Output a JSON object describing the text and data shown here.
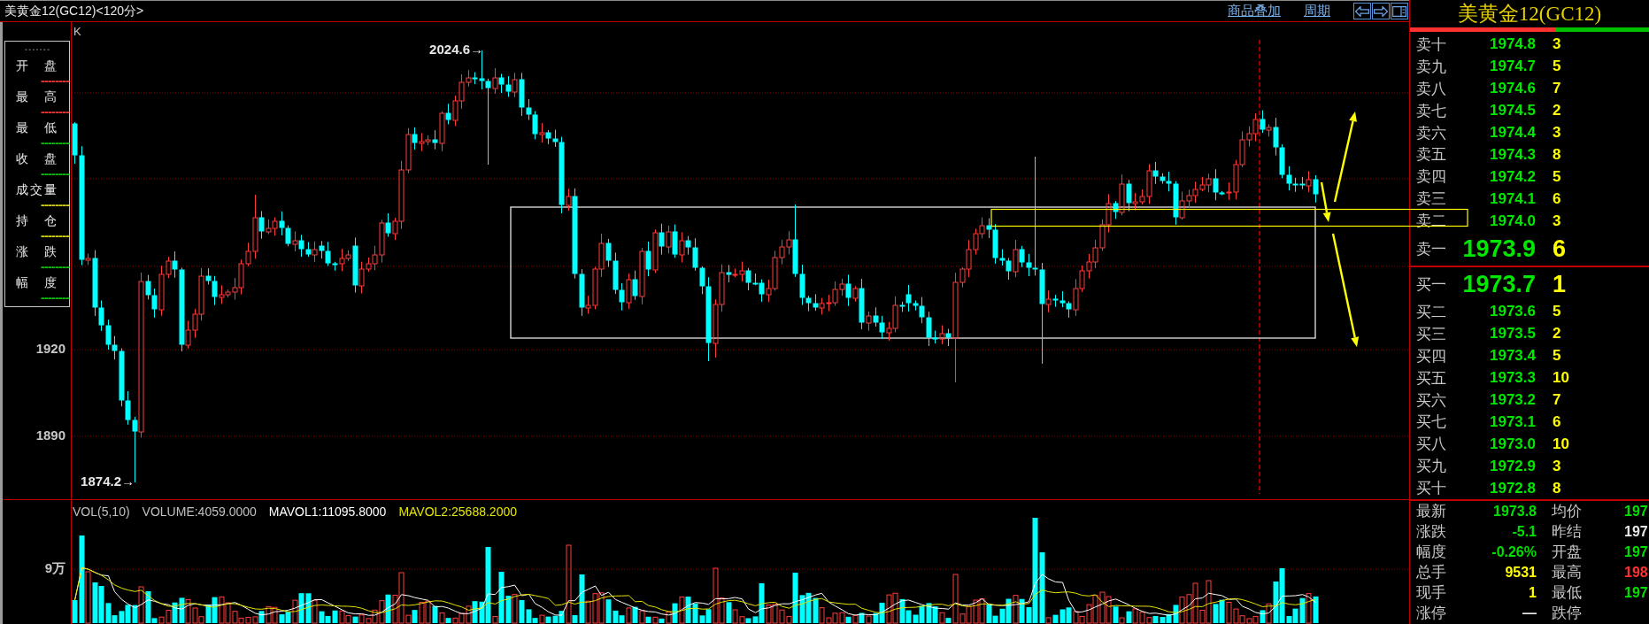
{
  "title_bar": {
    "title": "美黄金12(GC12)<120分>",
    "links": [
      {
        "label": "商品叠加"
      },
      {
        "label": "周期"
      }
    ],
    "tools": [
      {
        "kind": "left"
      },
      {
        "kind": "right"
      },
      {
        "kind": "layout"
      }
    ]
  },
  "info_panel": {
    "header": "-------",
    "fields": [
      {
        "label": "开盘",
        "value": "--------",
        "color": "#ff3030"
      },
      {
        "label": "最高",
        "value": "--------",
        "color": "#ff3030"
      },
      {
        "label": "最低",
        "value": "--------",
        "color": "#00c800"
      },
      {
        "label": "收盘",
        "value": "--------",
        "color": "#00c800"
      },
      {
        "label": "成交量",
        "value": "--------",
        "color": "#d8d800"
      },
      {
        "label": "持仓",
        "value": "--------",
        "color": "#d8d800"
      },
      {
        "label": "涨跌",
        "value": "--------",
        "color": "#00c800"
      },
      {
        "label": "幅度",
        "value": "--------",
        "color": "#00c800"
      }
    ]
  },
  "price_chart": {
    "marker": "K",
    "axis_labels": [
      "1920",
      "1890"
    ],
    "high_label": "2024.6→",
    "low_label": "1874.2→"
  },
  "volume_chart": {
    "legend": [
      {
        "text": "VOL(5,10)",
        "color": "#c0c0c0"
      },
      {
        "text": "VOLUME:4059.0000",
        "color": "#c0c0c0"
      },
      {
        "text": "MAVOL1:11095.8000",
        "color": "#ffffff"
      },
      {
        "text": "MAVOL2:25688.2000",
        "color": "#e6e600"
      }
    ],
    "axis_labels": [
      "9万"
    ]
  },
  "quote": {
    "title": "美黄金12(GC12)",
    "ratio_bar": {
      "level": 0.61
    },
    "asks": [
      {
        "label": "卖十",
        "price": "1974.8",
        "volume": "3",
        "kind": "depth"
      },
      {
        "label": "卖九",
        "price": "1974.7",
        "volume": "5",
        "kind": "depth"
      },
      {
        "label": "卖八",
        "price": "1974.6",
        "volume": "7",
        "kind": "depth"
      },
      {
        "label": "卖七",
        "price": "1974.5",
        "volume": "2",
        "kind": "depth"
      },
      {
        "label": "卖六",
        "price": "1974.4",
        "volume": "3",
        "kind": "depth"
      },
      {
        "label": "卖五",
        "price": "1974.3",
        "volume": "8",
        "kind": "depth"
      },
      {
        "label": "卖四",
        "price": "1974.2",
        "volume": "5",
        "kind": "depth"
      },
      {
        "label": "卖三",
        "price": "1974.1",
        "volume": "6",
        "kind": "depth"
      },
      {
        "label": "卖二",
        "price": "1974.0",
        "volume": "3",
        "kind": "depth"
      },
      {
        "label": "卖一",
        "price": "1973.9",
        "volume": "6",
        "kind": "best"
      }
    ],
    "bids": [
      {
        "label": "买一",
        "price": "1973.7",
        "volume": "1",
        "kind": "best"
      },
      {
        "label": "买二",
        "price": "1973.6",
        "volume": "5",
        "kind": "depth"
      },
      {
        "label": "买三",
        "price": "1973.5",
        "volume": "2",
        "kind": "depth"
      },
      {
        "label": "买四",
        "price": "1973.4",
        "volume": "5",
        "kind": "depth"
      },
      {
        "label": "买五",
        "price": "1973.3",
        "volume": "10",
        "kind": "depth"
      },
      {
        "label": "买六",
        "price": "1973.2",
        "volume": "7",
        "kind": "depth"
      },
      {
        "label": "买七",
        "price": "1973.1",
        "volume": "6",
        "kind": "depth"
      },
      {
        "label": "买八",
        "price": "1973.0",
        "volume": "10",
        "kind": "depth"
      },
      {
        "label": "买九",
        "price": "1972.9",
        "volume": "3",
        "kind": "depth"
      },
      {
        "label": "买十",
        "price": "1972.8",
        "volume": "8",
        "kind": "depth"
      }
    ],
    "stats": [
      {
        "cells": [
          {
            "label": "最新",
            "value": "1973.8",
            "color": "#00e000"
          },
          {
            "label": "均价",
            "value": "197",
            "color": "#00e000"
          }
        ]
      },
      {
        "cells": [
          {
            "label": "涨跌",
            "value": "-5.1",
            "color": "#00e000"
          },
          {
            "label": "昨结",
            "value": "197",
            "color": "#e8e8e8"
          }
        ]
      },
      {
        "cells": [
          {
            "label": "幅度",
            "value": "-0.26%",
            "color": "#00e000"
          },
          {
            "label": "开盘",
            "value": "197",
            "color": "#00e000"
          }
        ]
      },
      {
        "cells": [
          {
            "label": "总手",
            "value": "9531",
            "color": "#ffff00"
          },
          {
            "label": "最高",
            "value": "198",
            "color": "#ff3030"
          }
        ]
      },
      {
        "cells": [
          {
            "label": "现手",
            "value": "1",
            "color": "#ffff00"
          },
          {
            "label": "最低",
            "value": "197",
            "color": "#00e000"
          }
        ]
      },
      {
        "cells": [
          {
            "label": "涨停",
            "value": "—",
            "color": "#e8e8e8"
          },
          {
            "label": "跌停"
          }
        ]
      }
    ]
  }
}
